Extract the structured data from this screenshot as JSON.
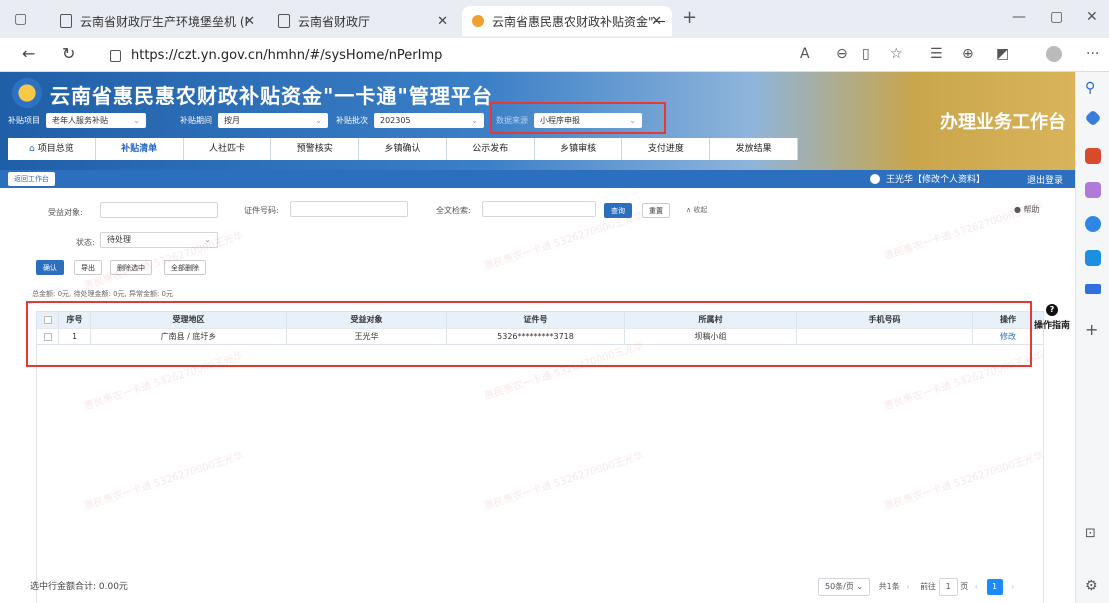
{
  "browser": {
    "tabs": [
      {
        "title": "云南省财政厅生产环境堡垒机 (I"
      },
      {
        "title": "云南省财政厅"
      },
      {
        "title": "云南省惠民惠农财政补贴资金\"一"
      }
    ],
    "url": "https://czt.yn.gov.cn/hmhn/#/sysHome/nPerImp"
  },
  "header": {
    "platform_title": "云南省惠民惠农财政补贴资金\"一卡通\"管理平台",
    "workspace_title": "办理业务工作台"
  },
  "filters": {
    "project_label": "补贴项目",
    "project_value": "老年人服务补贴",
    "period_label": "补贴期间",
    "period_value": "按月",
    "batch_label": "补贴批次",
    "batch_value": "202305",
    "source_label": "数据来源",
    "source_value": "小程序申报"
  },
  "steps": [
    {
      "label": "项目总览"
    },
    {
      "label": "补贴清单"
    },
    {
      "label": "人社匹卡"
    },
    {
      "label": "预警核实"
    },
    {
      "label": "乡镇确认"
    },
    {
      "label": "公示发布"
    },
    {
      "label": "乡镇审核"
    },
    {
      "label": "支付进度"
    },
    {
      "label": "发放结果"
    }
  ],
  "topbar": {
    "back_label": "返回工作台",
    "user": "王光华【修改个人资料】",
    "logout": "退出登录"
  },
  "search": {
    "beneficiary_label": "受益对象:",
    "idno_label": "证件号码:",
    "fulltext_label": "全文检索:",
    "query_btn": "查询",
    "reset_btn": "重置",
    "collapse_btn": "∧ 收起",
    "status_label": "状态:",
    "status_value": "待处理",
    "help": "帮助"
  },
  "actions": {
    "confirm": "确认",
    "export": "导出",
    "delete_selected": "删除选中",
    "delete_all": "全部删除"
  },
  "summary": "总金额: 0元,  待处理金额: 0元,  异常金额: 0元",
  "table": {
    "headers": [
      "序号",
      "受理地区",
      "受益对象",
      "证件号",
      "所属村",
      "手机号码",
      "操作"
    ],
    "rows": [
      {
        "no": "1",
        "region": "广南县 / 底圩乡",
        "name": "王光华",
        "id": "5326*********3718",
        "village": "坝稿小组",
        "phone": "",
        "op": "修改"
      }
    ]
  },
  "guide": "操作指南",
  "footer": {
    "selected_total": "选中行金额合计: 0.00元",
    "page_size": "50条/页",
    "total": "共1条",
    "goto": "前往",
    "page_input": "1",
    "page_unit": "页",
    "current_page": "1"
  },
  "watermark": "惠民惠农一卡通 5326270000王光华",
  "colors": {
    "primary": "#2d6fbf",
    "highlight": "#e53935"
  }
}
